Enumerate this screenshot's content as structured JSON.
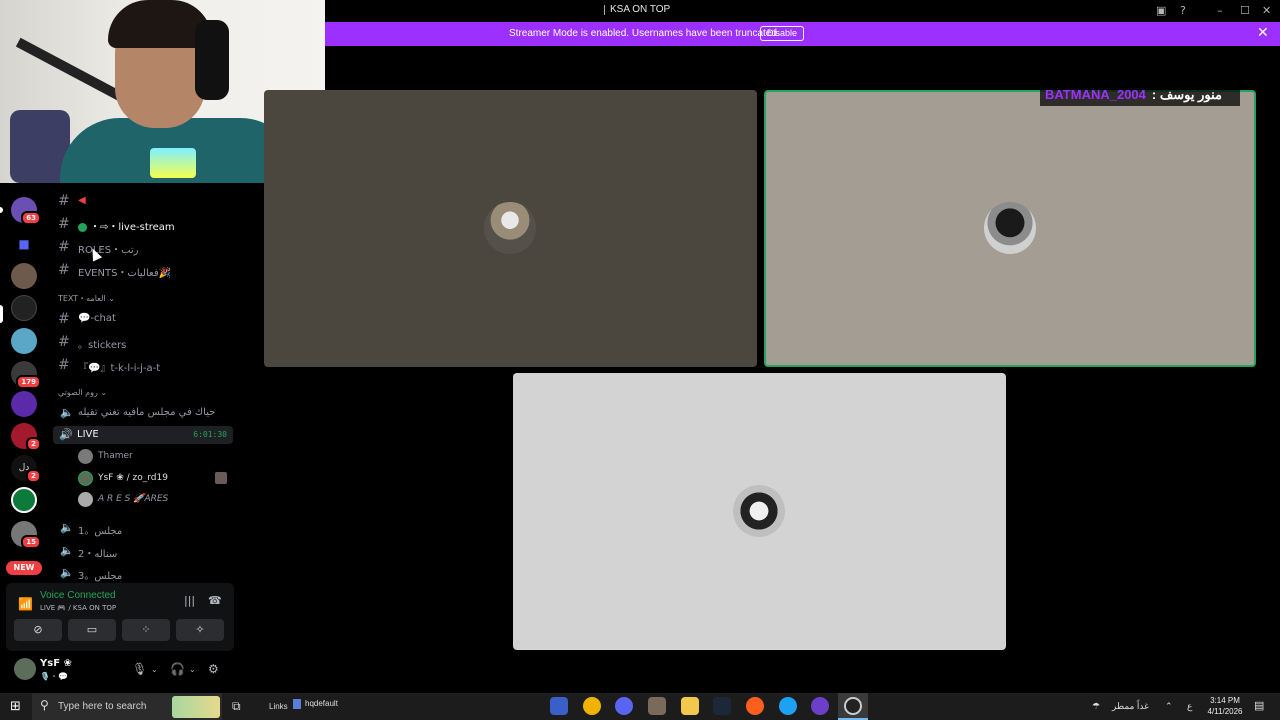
{
  "window": {
    "title": "KSA ON TOP"
  },
  "banner": {
    "message": "Streamer Mode is enabled. Usernames have been truncated.",
    "disable_label": "Disable"
  },
  "overlay": {
    "handle": "BATMANA_2004",
    "name": ": منور يوسف"
  },
  "servers": [
    {
      "badge": "63"
    },
    {
      "badge": ""
    },
    {
      "badge": ""
    },
    {
      "badge": ""
    },
    {
      "badge": "179"
    },
    {
      "badge": ""
    },
    {
      "badge": "2"
    },
    {
      "badge": "2"
    },
    {
      "badge": ""
    },
    {
      "badge": "15"
    }
  ],
  "server_new_label": "NEW",
  "channels": {
    "top": [
      {
        "label": ""
      },
      {
        "label": "・⇨・live-stream"
      },
      {
        "label": "ROLES・رتب"
      },
      {
        "label": "EVENTS・فعاليات🎉"
      }
    ],
    "text_category": "TEXT・العامه",
    "text": [
      {
        "label": "💬-chat"
      },
      {
        "label": "。stickers"
      },
      {
        "label": "『💬』t-k-l-i-j-a-t"
      }
    ],
    "voice_category": "روم الصوتي",
    "voice_top": {
      "label": "حياك في مجلس مافيه تغني تقيله"
    },
    "live": {
      "label": "LIVE",
      "timer": "6:01:30"
    },
    "members": [
      {
        "name": "Thamer"
      },
      {
        "name": "YsF ❀ / zo_rd19"
      },
      {
        "name": "A R E S 🚀ARES"
      }
    ],
    "voice_bottom": [
      {
        "label": "مجلس。1"
      },
      {
        "label": "سناله・2"
      },
      {
        "label": "مجلس。3"
      }
    ]
  },
  "voice_panel": {
    "status": "Voice Connected",
    "subtitle": "LIVE 🎮 / KSA ON TOP"
  },
  "user_panel": {
    "name": "YsF ❀",
    "status": "🎙️・💬"
  },
  "taskbar": {
    "search_placeholder": "Type here to search",
    "links": "Links",
    "window_item": "hqdefault",
    "weather": "غداً ممطر",
    "lang": "ع",
    "time": "3:14 PM",
    "date": "4/11/2026"
  }
}
